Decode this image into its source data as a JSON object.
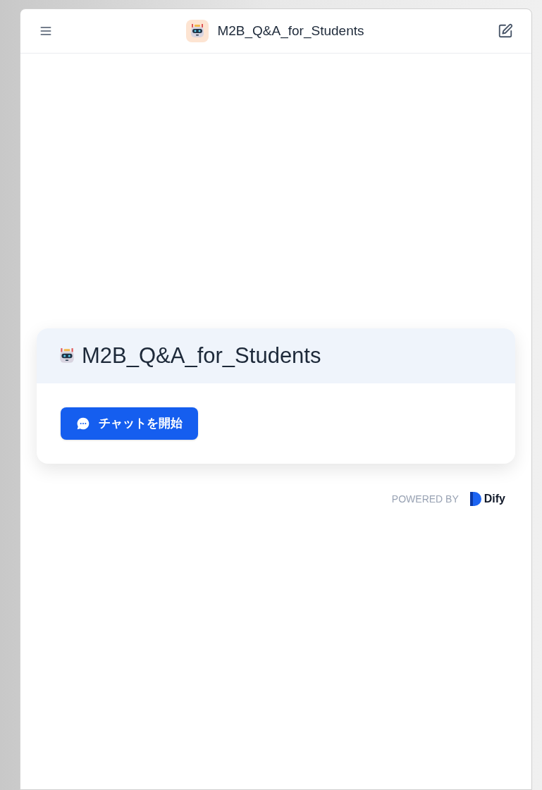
{
  "header": {
    "title": "M2B_Q&A_for_Students"
  },
  "card": {
    "title": "M2B_Q&A_for_Students",
    "button": "チャットを開始"
  },
  "footer": {
    "powered_by": "POWERED BY",
    "brand": "Dify"
  }
}
